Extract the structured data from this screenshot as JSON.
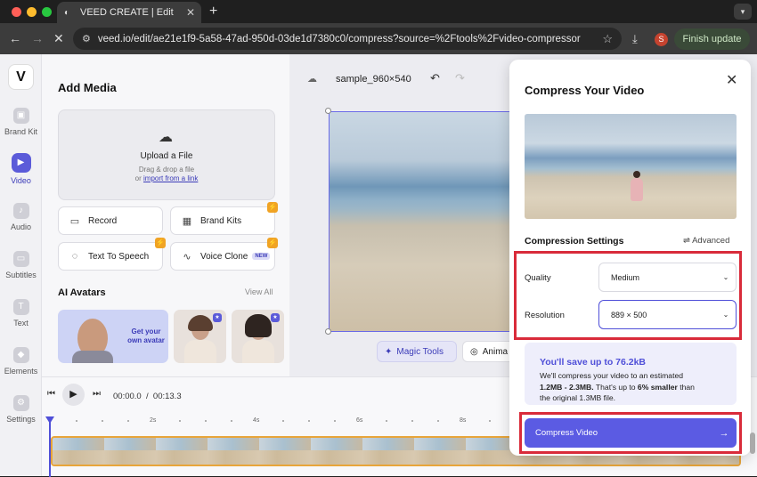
{
  "browser": {
    "tab_title": "VEED CREATE | Edit",
    "url": "veed.io/edit/ae21e1f9-5a58-47ad-950d-03de1d7380c0/compress?source=%2Ftools%2Fvideo-compressor",
    "profile_initial": "S",
    "finish_update": "Finish update"
  },
  "sidebar": {
    "logo": "V",
    "items": [
      {
        "label": "Brand Kit"
      },
      {
        "label": "Video"
      },
      {
        "label": "Audio"
      },
      {
        "label": "Subtitles"
      },
      {
        "label": "Text"
      },
      {
        "label": "Elements"
      },
      {
        "label": "Settings"
      }
    ]
  },
  "media_panel": {
    "title": "Add Media",
    "upload": {
      "title": "Upload a File",
      "subtitle": "Drag & drop a file",
      "or": "or",
      "link": "import from a link"
    },
    "buttons": {
      "record": "Record",
      "brand_kits": "Brand Kits",
      "text_to_speech": "Text To Speech",
      "voice_clone": "Voice Clone",
      "new_badge": "NEW"
    },
    "avatars": {
      "title": "AI Avatars",
      "view_all": "View All",
      "cta": "Get your own avatar"
    }
  },
  "canvas": {
    "project_name": "sample_960×540",
    "magic_tools": "Magic Tools",
    "animate": "Anima"
  },
  "timeline": {
    "current_time": "00:00.0",
    "separator": "/",
    "total_time": "00:13.3",
    "ticks": [
      "2s",
      "4s",
      "6s",
      "8s"
    ]
  },
  "modal": {
    "title": "Compress Your Video",
    "settings_title": "Compression Settings",
    "advanced": "Advanced",
    "quality_label": "Quality",
    "quality_value": "Medium",
    "resolution_label": "Resolution",
    "resolution_value": "889 × 500",
    "savings_title": "You'll save up to 76.2kB",
    "savings_line1": "We'll compress your video to an estimated",
    "savings_size": "1.2MB - 2.3MB.",
    "savings_line2a": "That's up to",
    "savings_pct": "6% smaller",
    "savings_line2b": "than",
    "savings_line3": "the original 1.3MB file.",
    "compress_button": "Compress Video"
  },
  "colors": {
    "accent": "#5b5be3",
    "highlight_outline": "#d92b3a"
  }
}
